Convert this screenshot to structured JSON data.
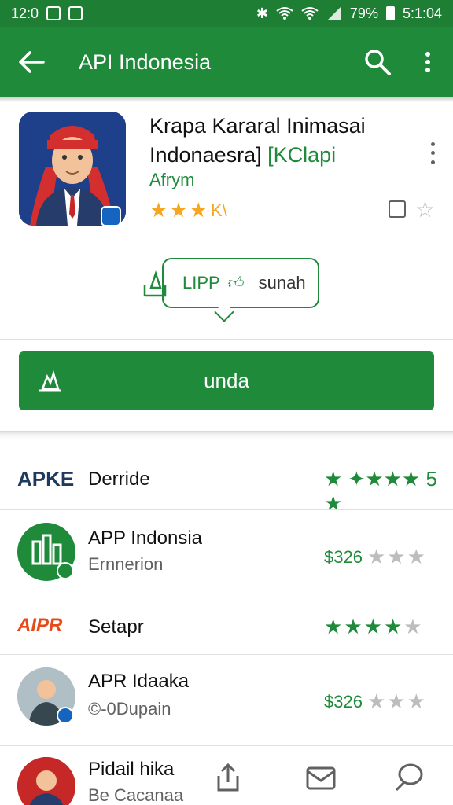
{
  "status_bar": {
    "time": "12:0",
    "battery": "79%",
    "clock_right": "5:1:04"
  },
  "app_bar": {
    "title": "API Indonesia"
  },
  "app": {
    "name": "Krapa Kararal Inimasai Indonaesra]",
    "developer": "[KClapi",
    "subtitle": "Afrym",
    "rating_text": "K\\"
  },
  "bubble": {
    "title": "LIPP",
    "text": "sunah"
  },
  "install_button": {
    "label": "unda"
  },
  "list": [
    {
      "logo_text": "APKE",
      "title": "Derride",
      "sub": "",
      "rating_text": "★ ✦★★★ 5 ★"
    },
    {
      "title": "APP Indonsia",
      "sub": "Ernnerion",
      "price": "$326"
    },
    {
      "logo_text": "AIPR",
      "title": "Setapr"
    },
    {
      "title": "APR Idaaka",
      "sub": "©-0Dupain",
      "price": "$326"
    },
    {
      "title": "Pidail hika",
      "sub": "Be Cacanaa"
    }
  ],
  "colors": {
    "primary": "#1e8a3a",
    "status_bar": "#1e7e34",
    "star_gold": "#f5a623",
    "star_empty": "#bdbdbd"
  }
}
